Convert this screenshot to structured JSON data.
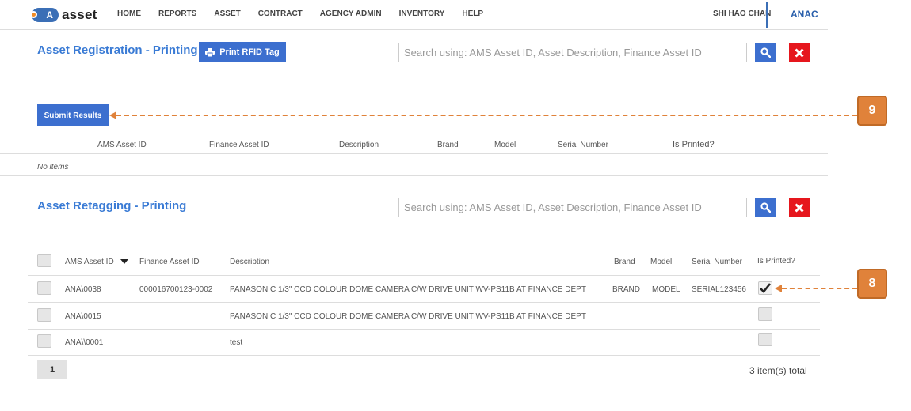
{
  "nav": {
    "logo_badge": "A",
    "logo_text": "asset",
    "items": [
      "HOME",
      "REPORTS",
      "ASSET",
      "CONTRACT",
      "AGENCY ADMIN",
      "INVENTORY",
      "HELP"
    ],
    "user": "SHI HAO CHAN",
    "agency": "ANAC"
  },
  "registration": {
    "title": "Asset Registration - Printing",
    "print_button": "Print RFID Tag",
    "search_placeholder": "Search using: AMS Asset ID, Asset Description, Finance Asset ID",
    "submit_button": "Submit Results",
    "columns": [
      "AMS Asset ID",
      "Finance Asset ID",
      "Description",
      "Brand",
      "Model",
      "Serial Number",
      "Is Printed?"
    ],
    "empty_text": "No items"
  },
  "retagging": {
    "title": "Asset Retagging - Printing",
    "search_placeholder": "Search using: AMS Asset ID, Asset Description, Finance Asset ID",
    "columns": [
      "AMS Asset ID",
      "Finance Asset ID",
      "Description",
      "Brand",
      "Model",
      "Serial Number",
      "Is Printed?"
    ],
    "rows": [
      {
        "ams_id": "ANA\\0038",
        "finance_id": "000016700123-0002",
        "description": "PANASONIC 1/3\" CCD COLOUR DOME CAMERA C/W DRIVE UNIT WV-PS11B AT FINANCE DEPT",
        "brand": "BRAND",
        "model": "MODEL",
        "serial": "SERIAL123456",
        "printed": true
      },
      {
        "ams_id": "ANA\\0015",
        "finance_id": "",
        "description": "PANASONIC 1/3\" CCD COLOUR DOME CAMERA C/W DRIVE UNIT WV-PS11B AT FINANCE DEPT",
        "brand": "",
        "model": "",
        "serial": "",
        "printed": false
      },
      {
        "ams_id": "ANA\\\\0001",
        "finance_id": "",
        "description": "test",
        "brand": "",
        "model": "",
        "serial": "",
        "printed": false
      }
    ],
    "page": "1",
    "total": "3 item(s) total"
  },
  "callouts": {
    "submit": "9",
    "printed_checkbox": "8"
  },
  "colors": {
    "accent": "#3c6fcf",
    "title": "#3a7bd5",
    "danger": "#e6161d",
    "callout": "#e0823a"
  }
}
